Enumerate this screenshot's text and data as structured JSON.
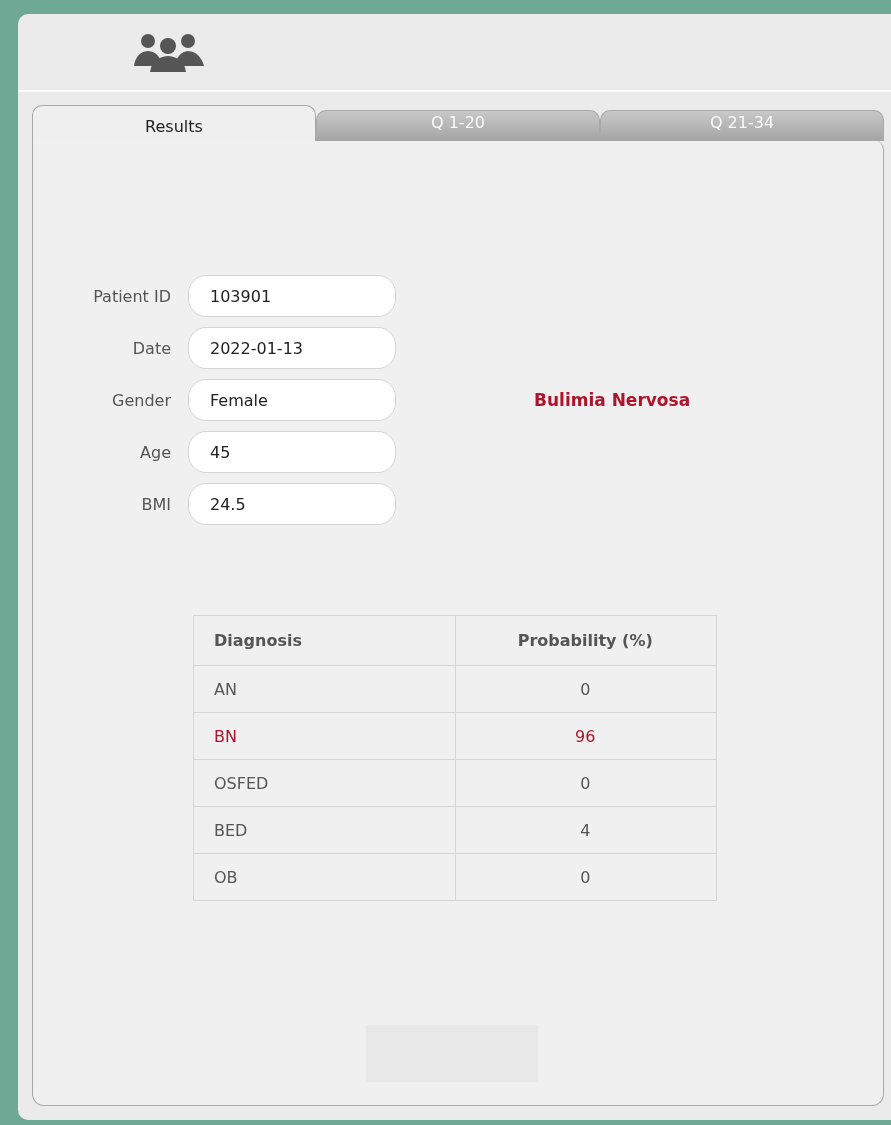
{
  "tabs": [
    {
      "label": "Results",
      "selected": true
    },
    {
      "label": "Q 1-20",
      "selected": false
    },
    {
      "label": "Q 21-34",
      "selected": false
    }
  ],
  "patient_fields": [
    {
      "label": "Patient ID",
      "value": "103901"
    },
    {
      "label": "Date",
      "value": "2022-01-13"
    },
    {
      "label": "Gender",
      "value": "Female"
    },
    {
      "label": "Age",
      "value": "45"
    },
    {
      "label": "BMI",
      "value": "24.5"
    }
  ],
  "diagnosis_result": "Bulimia Nervosa",
  "table": {
    "columns": [
      "Diagnosis",
      "Probability (%)"
    ],
    "rows": [
      {
        "diagnosis": "AN",
        "probability": "0",
        "highlighted": false
      },
      {
        "diagnosis": "BN",
        "probability": "96",
        "highlighted": true
      },
      {
        "diagnosis": "OSFED",
        "probability": "0",
        "highlighted": false
      },
      {
        "diagnosis": "BED",
        "probability": "4",
        "highlighted": false
      },
      {
        "diagnosis": "OB",
        "probability": "0",
        "highlighted": false
      }
    ]
  }
}
